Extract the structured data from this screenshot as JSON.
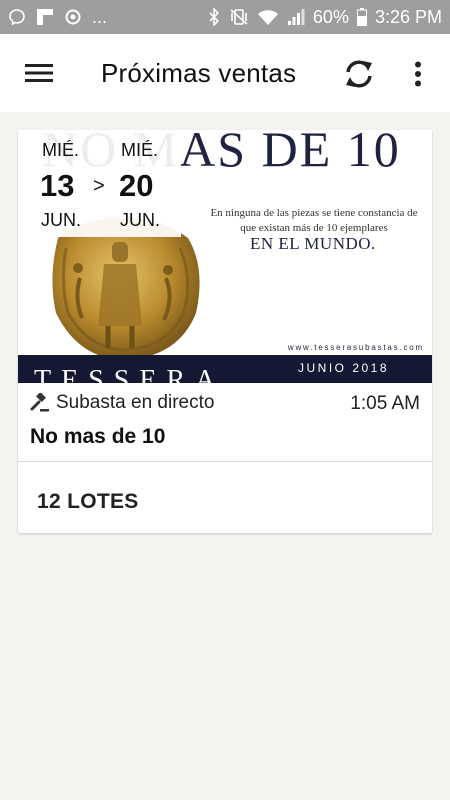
{
  "status_bar": {
    "left_icons": [
      "messenger-icon",
      "flipboard-icon",
      "sync-icon"
    ],
    "more": "...",
    "right_icons": [
      "bluetooth-icon",
      "vibrate-icon",
      "wifi-icon",
      "signal-icon"
    ],
    "battery_percent": "60%",
    "time": "3:26 PM"
  },
  "app_bar": {
    "title": "Próximas ventas",
    "menu_icon": "hamburger-menu-icon",
    "refresh_icon": "refresh-icon",
    "more_icon": "more-vert-icon"
  },
  "auction_card": {
    "banner": {
      "headline": "NO MAS DE 10",
      "description": "En ninguna de las piezas se tiene constancia de que existan más de 10 ejemplares",
      "highlight": "EN EL MUNDO.",
      "url": "www.tesserasubastas.com",
      "brand": "TESSERA",
      "date": "JUNIO 2018"
    },
    "start": {
      "weekday": "MIÉ.",
      "day": "13",
      "month": "JUN."
    },
    "separator": ">",
    "end": {
      "weekday": "MIÉ.",
      "day": "20",
      "month": "JUN."
    },
    "type_label": "Subasta en directo",
    "time": "1:05 AM",
    "name": "No mas de 10",
    "lots_label": "12 LOTES"
  },
  "colors": {
    "status_bar": "#9e9e9e",
    "app_bar": "#ffffff",
    "background": "#f4f3f0",
    "banner_navy": "#141833"
  }
}
